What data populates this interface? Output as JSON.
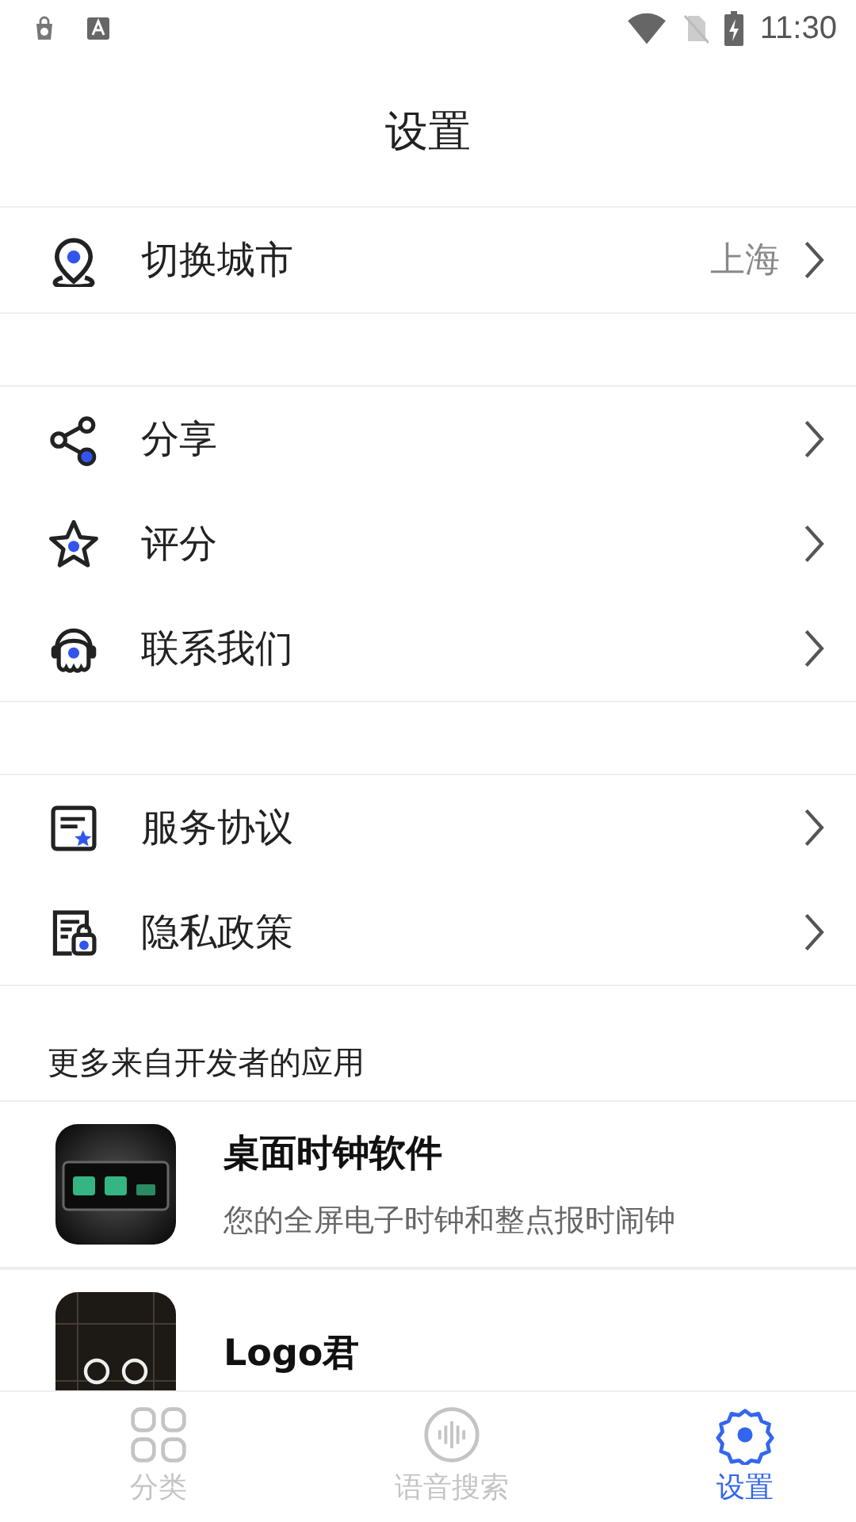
{
  "status_bar": {
    "time": "11:30"
  },
  "header": {
    "title": "设置"
  },
  "sections": [
    {
      "items": [
        {
          "kind": "location",
          "label": "切换城市",
          "value": "上海"
        }
      ]
    },
    {
      "items": [
        {
          "kind": "share",
          "label": "分享"
        },
        {
          "kind": "star",
          "label": "评分"
        },
        {
          "kind": "support",
          "label": "联系我们"
        }
      ]
    },
    {
      "items": [
        {
          "kind": "terms",
          "label": "服务协议"
        },
        {
          "kind": "privacy",
          "label": "隐私政策"
        }
      ]
    }
  ],
  "more_apps": {
    "title": "更多来自开发者的应用",
    "apps": [
      {
        "kind": "clock",
        "name": "桌面时钟软件",
        "description": "您的全屏电子时钟和整点报时闹钟"
      },
      {
        "kind": "logo",
        "name": "Logo君"
      }
    ]
  },
  "tab_bar": [
    {
      "kind": "grid",
      "label": "分类",
      "selected": false
    },
    {
      "kind": "voice",
      "label": "语音搜索",
      "selected": false
    },
    {
      "kind": "gear",
      "label": "设置",
      "selected": true
    }
  ]
}
